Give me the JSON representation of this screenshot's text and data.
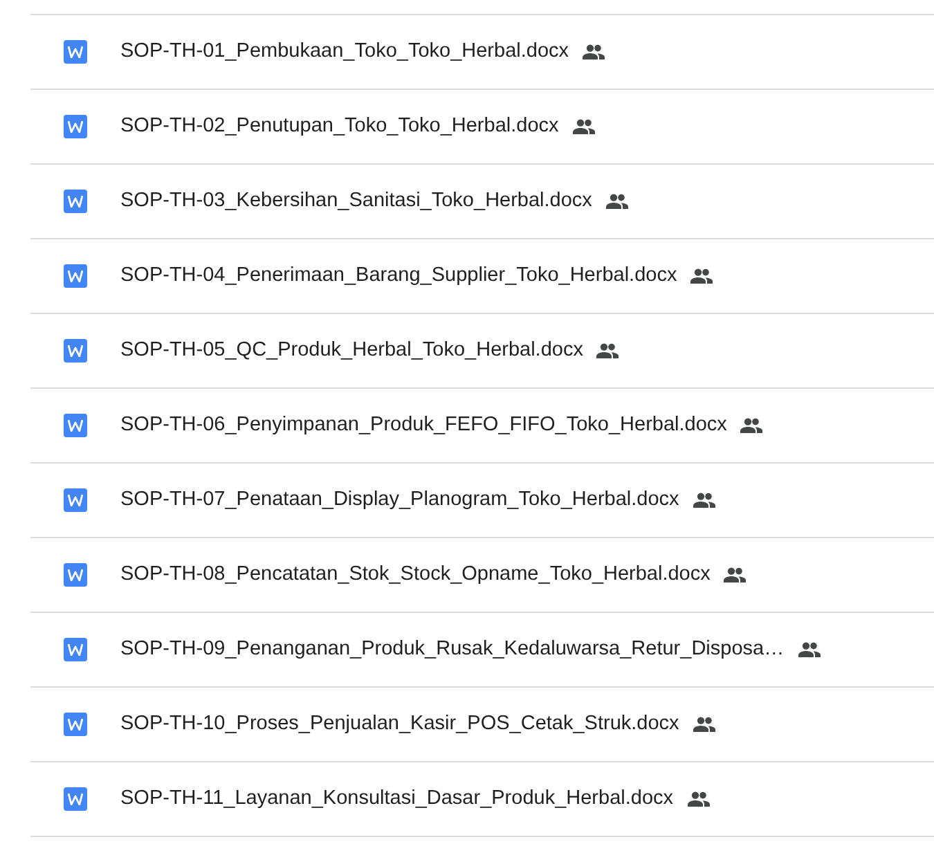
{
  "files": [
    {
      "name": "SOP-TH-01_Pembukaan_Toko_Toko_Herbal.docx",
      "shared": true
    },
    {
      "name": "SOP-TH-02_Penutupan_Toko_Toko_Herbal.docx",
      "shared": true
    },
    {
      "name": "SOP-TH-03_Kebersihan_Sanitasi_Toko_Herbal.docx",
      "shared": true
    },
    {
      "name": "SOP-TH-04_Penerimaan_Barang_Supplier_Toko_Herbal.docx",
      "shared": true
    },
    {
      "name": "SOP-TH-05_QC_Produk_Herbal_Toko_Herbal.docx",
      "shared": true
    },
    {
      "name": "SOP-TH-06_Penyimpanan_Produk_FEFO_FIFO_Toko_Herbal.docx",
      "shared": true
    },
    {
      "name": "SOP-TH-07_Penataan_Display_Planogram_Toko_Herbal.docx",
      "shared": true
    },
    {
      "name": "SOP-TH-08_Pencatatan_Stok_Stock_Opname_Toko_Herbal.docx",
      "shared": true
    },
    {
      "name": "SOP-TH-09_Penanganan_Produk_Rusak_Kedaluwarsa_Retur_Disposa…",
      "shared": true
    },
    {
      "name": "SOP-TH-10_Proses_Penjualan_Kasir_POS_Cetak_Struk.docx",
      "shared": true
    },
    {
      "name": "SOP-TH-11_Layanan_Konsultasi_Dasar_Produk_Herbal.docx",
      "shared": true
    }
  ]
}
